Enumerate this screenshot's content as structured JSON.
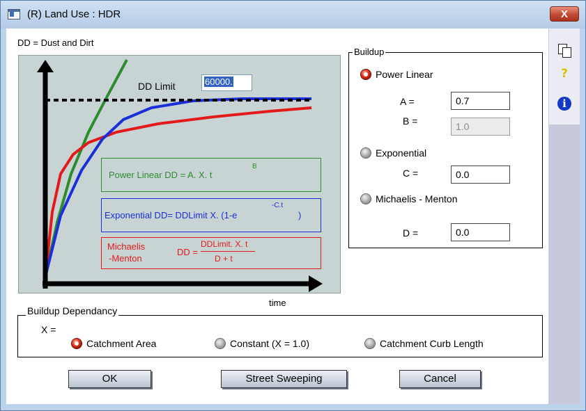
{
  "window": {
    "title": "(R) Land Use : HDR",
    "close_label": "X"
  },
  "side_toolbar": {
    "icons": [
      "copy-icon",
      "help-icon",
      "info-icon"
    ],
    "help_glyph": "?",
    "info_glyph": "i"
  },
  "caption": "DD = Dust and Dirt",
  "diagram": {
    "dd_limit_label": "DD  Limit",
    "dd_limit_value": "60000.",
    "time_label": "time",
    "power_linear": {
      "text": "Power Linear  DD  = A. X. t",
      "sup": "B"
    },
    "exponential": {
      "text": "Exponential DD= DDLimit  X. (1-e",
      "sup": "-C.t",
      "tail": ")"
    },
    "michaelis": {
      "name_line1": "Michaelis",
      "name_line2": "-Menton",
      "dd_eq": "DD =",
      "numerator": "DDLimit. X. t",
      "denominator": "D + t"
    },
    "colors": {
      "power_linear": "#2e8b2e",
      "exponential": "#1a2fd8",
      "michaelis": "#e31a1a",
      "limit_line": "#000000"
    }
  },
  "buildup": {
    "legend": "Buildup",
    "power_linear": {
      "label": "Power Linear",
      "selected": true
    },
    "A": {
      "label": "A =",
      "value": "0.7"
    },
    "B": {
      "label": "B =",
      "value": "1.0"
    },
    "exponential": {
      "label": "Exponential",
      "selected": false
    },
    "C": {
      "label": "C =",
      "value": "0.0"
    },
    "michaelis": {
      "label": "Michaelis - Menton",
      "selected": false
    },
    "D": {
      "label": "D =",
      "value": "0.0"
    }
  },
  "dependancy": {
    "legend": "Buildup Dependancy",
    "x_label": "X =",
    "options": [
      {
        "label": "Catchment Area",
        "selected": true
      },
      {
        "label": "Constant (X = 1.0)",
        "selected": false
      },
      {
        "label": "Catchment Curb Length",
        "selected": false
      }
    ]
  },
  "buttons": {
    "ok": "OK",
    "street_sweeping": "Street Sweeping",
    "cancel": "Cancel"
  }
}
